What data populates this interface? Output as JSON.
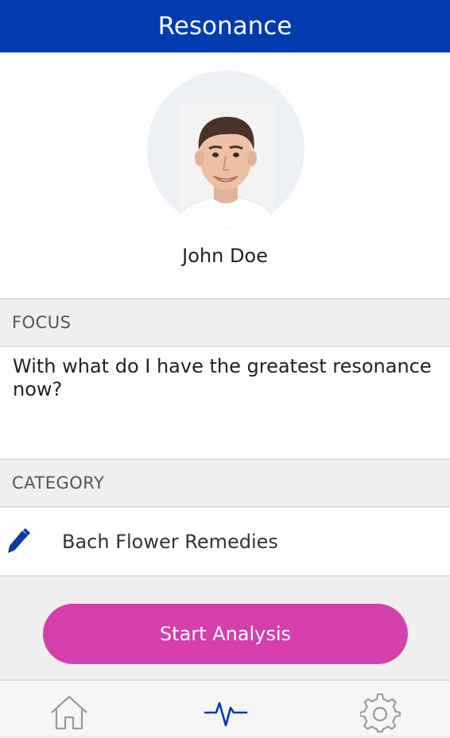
{
  "header": {
    "title": "Resonance"
  },
  "profile": {
    "name": "John Doe",
    "avatar_icon": "person-photo"
  },
  "focus": {
    "header": "FOCUS",
    "text": "With what do I have the greatest resonance now?"
  },
  "category": {
    "header": "CATEGORY",
    "value": "Bach Flower Remedies",
    "edit_icon": "pencil-icon"
  },
  "actions": {
    "start_label": "Start Analysis"
  },
  "tabbar": {
    "items": [
      {
        "name": "home",
        "icon": "home-icon",
        "active": false
      },
      {
        "name": "analysis",
        "icon": "pulse-icon",
        "active": true
      },
      {
        "name": "settings",
        "icon": "gear-icon",
        "active": false
      }
    ]
  },
  "colors": {
    "brand": "#003bb0",
    "button": "#d43fac",
    "active_tab": "#003bb0",
    "inactive_tab": "#9a9a9a"
  }
}
